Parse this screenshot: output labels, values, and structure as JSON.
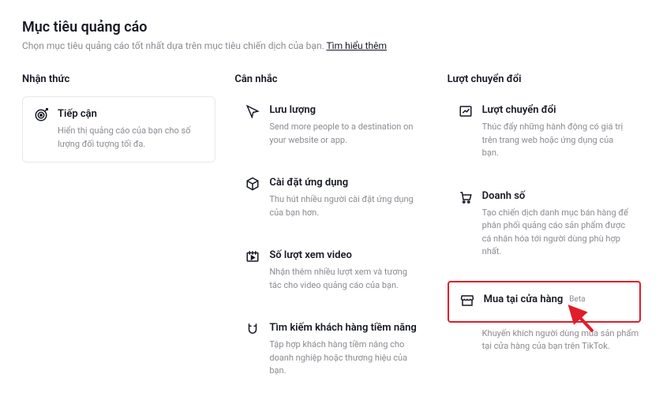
{
  "header": {
    "title": "Mục tiêu quảng cáo",
    "subtitle_prefix": "Chọn mục tiêu quảng cáo tốt nhất dựa trên mục tiêu chiến dịch của bạn. ",
    "learn_more": "Tìm hiểu thêm"
  },
  "columns": {
    "awareness": {
      "heading": "Nhận thức",
      "reach": {
        "title": "Tiếp cận",
        "desc": "Hiển thị quảng cáo của bạn cho số lượng đối tượng tối đa."
      }
    },
    "consideration": {
      "heading": "Cân nhắc",
      "traffic": {
        "title": "Lưu lượng",
        "desc": "Send more people to a destination on your website or app."
      },
      "app_install": {
        "title": "Cài đặt ứng dụng",
        "desc": "Thu hút nhiều người cài đặt ứng dụng của bạn hơn."
      },
      "video_views": {
        "title": "Số lượt xem video",
        "desc": "Nhận thêm nhiều lượt xem và tương tác cho video quảng cáo của bạn."
      },
      "lead_gen": {
        "title": "Tìm kiếm khách hàng tiềm năng",
        "desc": "Tập hợp khách hàng tiềm năng cho doanh nghiệp hoặc thương hiệu của bạn."
      }
    },
    "conversion": {
      "heading": "Lượt chuyển đổi",
      "conversions": {
        "title": "Lượt chuyển đổi",
        "desc": "Thúc đẩy những hành động có giá trị trên trang web hoặc ứng dụng của bạn."
      },
      "sales": {
        "title": "Doanh số",
        "desc": "Tạo chiến dịch danh mục bán hàng để phân phối quảng cáo sản phẩm được cá nhân hóa tới người dùng phù hợp nhất."
      },
      "shop_purchase": {
        "title": "Mua tại cửa hàng",
        "badge": "Beta",
        "desc": "Khuyến khích người dùng mua sản phẩm tại cửa hàng của bạn trên TikTok."
      }
    }
  }
}
